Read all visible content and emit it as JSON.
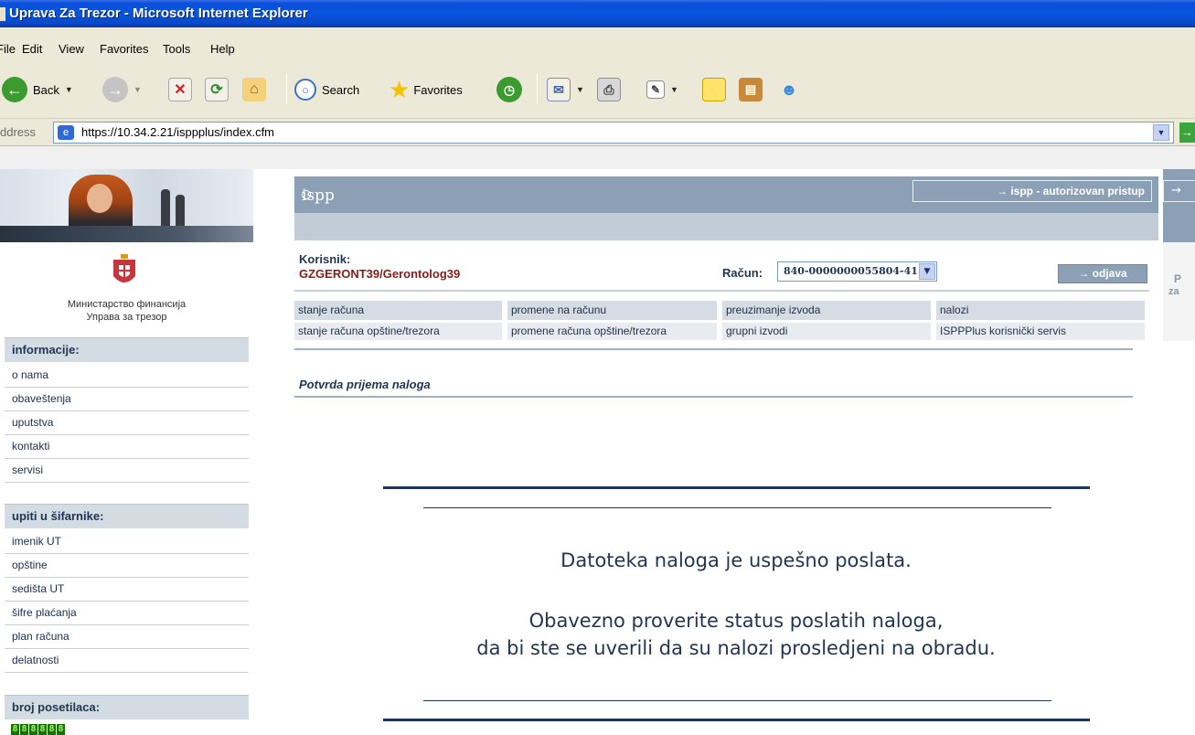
{
  "window": {
    "title": "Uprava Za Trezor - Microsoft Internet Explorer"
  },
  "menu": [
    "File",
    "Edit",
    "View",
    "Favorites",
    "Tools",
    "Help"
  ],
  "toolbar": {
    "back_label": "Back",
    "search_label": "Search",
    "favorites_label": "Favorites"
  },
  "address": {
    "label": "ddress",
    "url": "https://10.34.2.21/isppplus/index.cfm"
  },
  "header": {
    "site_title": "ispp",
    "auth_button": "→ ispp - autorizovan pristup",
    "right_arrow": "→",
    "right_peek": "P",
    "right_peek2": "za"
  },
  "ministry": {
    "line1": "Министарство финансија",
    "line2": "Управа за трезор"
  },
  "sidebar": {
    "info_title": "informacije:",
    "info_items": [
      "o nama",
      "obaveštenja",
      "uputstva",
      "kontakti",
      "servisi"
    ],
    "queries_title": "upiti u šifarnike:",
    "queries_items": [
      "imenik UT",
      "opštine",
      "sedišta UT",
      "šifre plaćanja",
      "plan računa",
      "delatnosti"
    ],
    "visitors_title": "broj posetilaca:",
    "visitor_digits": [
      "8",
      "8",
      "8",
      "8",
      "8",
      "8"
    ]
  },
  "user": {
    "label": "Korisnik:",
    "value": "GZGERONT39/Gerontolog39"
  },
  "account": {
    "label": "Račun:",
    "selected": "840-0000000055804-41"
  },
  "logout_label": "→ odjava",
  "nav": {
    "row1": [
      "stanje  računa",
      "promene na računu",
      "preuzimanje izvoda",
      "nalozi"
    ],
    "row2": [
      "stanje računa opštine/trezora",
      "promene računa opštine/trezora",
      "grupni izvodi",
      "ISPPPlus korisnički servis"
    ]
  },
  "content": {
    "section_title": "Potvrda prijema naloga",
    "message1": "Datoteka naloga je uspešno poslata.",
    "message2": "Obavezno proverite status poslatih naloga,",
    "message3": "da bi ste se uverili da su nalozi prosledjeni na obradu."
  },
  "colors": {
    "titlebar": "#0855dd",
    "header_bar": "#8ca0b5",
    "brand_text": "#1f3553",
    "user_red": "#8a1c17"
  }
}
